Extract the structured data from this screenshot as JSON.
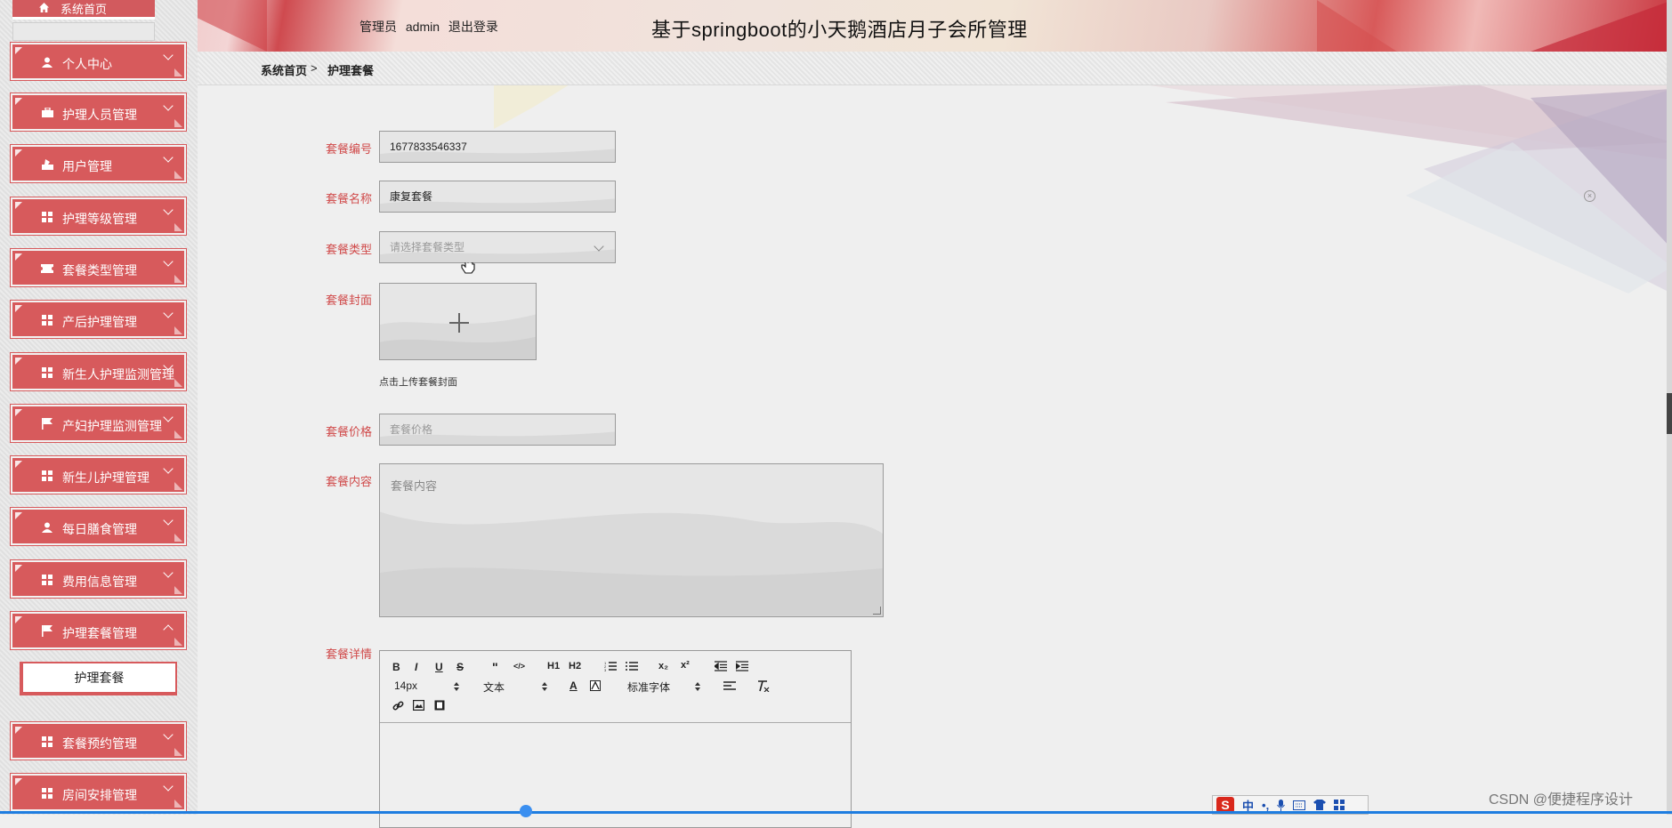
{
  "header": {
    "role_label": "管理员",
    "username": "admin",
    "logout_label": "退出登录",
    "site_title": "基于springboot的小天鹅酒店月子会所管理"
  },
  "sidebar": {
    "home_label": "系统首页",
    "items": [
      {
        "label": "个人中心",
        "icon": "user-icon"
      },
      {
        "label": "护理人员管理",
        "icon": "briefcase-icon"
      },
      {
        "label": "用户管理",
        "icon": "user-tie-icon"
      },
      {
        "label": "护理等级管理",
        "icon": "grid-icon"
      },
      {
        "label": "套餐类型管理",
        "icon": "ticket-icon"
      },
      {
        "label": "产后护理管理",
        "icon": "grid-icon"
      },
      {
        "label": "新生人护理监测管理",
        "icon": "grid-icon"
      },
      {
        "label": "产妇护理监测管理",
        "icon": "flag-icon"
      },
      {
        "label": "新生儿护理管理",
        "icon": "grid-icon"
      },
      {
        "label": "每日膳食管理",
        "icon": "user-icon"
      },
      {
        "label": "费用信息管理",
        "icon": "grid-icon"
      },
      {
        "label": "护理套餐管理",
        "icon": "flag-icon",
        "expanded": true
      },
      {
        "label": "套餐预约管理",
        "icon": "grid-icon"
      },
      {
        "label": "房间安排管理",
        "icon": "grid-icon"
      }
    ],
    "submenu_active": "护理套餐"
  },
  "breadcrumb": {
    "home": "系统首页",
    "separator": ">",
    "current": "护理套餐"
  },
  "form": {
    "code_label": "套餐编号",
    "code_value": "1677833546337",
    "name_label": "套餐名称",
    "name_value": "康复套餐",
    "type_label": "套餐类型",
    "type_placeholder": "请选择套餐类型",
    "cover_label": "套餐封面",
    "cover_hint": "点击上传套餐封面",
    "price_label": "套餐价格",
    "price_placeholder": "套餐价格",
    "content_label": "套餐内容",
    "content_placeholder": "套餐内容",
    "detail_label": "套餐详情"
  },
  "editor": {
    "font_size": "14px",
    "block_type": "文本",
    "font_family": "标准字体",
    "buttons": [
      "B",
      "I",
      "U",
      "S",
      "\"",
      "</>",
      "H1",
      "H2",
      "ol",
      "ul",
      "x₂",
      "x²",
      "outdent",
      "indent",
      "A",
      "bg",
      "align",
      "clear",
      "link",
      "image",
      "video"
    ]
  },
  "ime": {
    "logo": "S",
    "mode": "中",
    "punct": "•,"
  },
  "watermark": "CSDN @便捷程序设计",
  "colors": {
    "accent": "#d75a5c",
    "label_red": "#d04a4a",
    "background": "#efefef"
  }
}
